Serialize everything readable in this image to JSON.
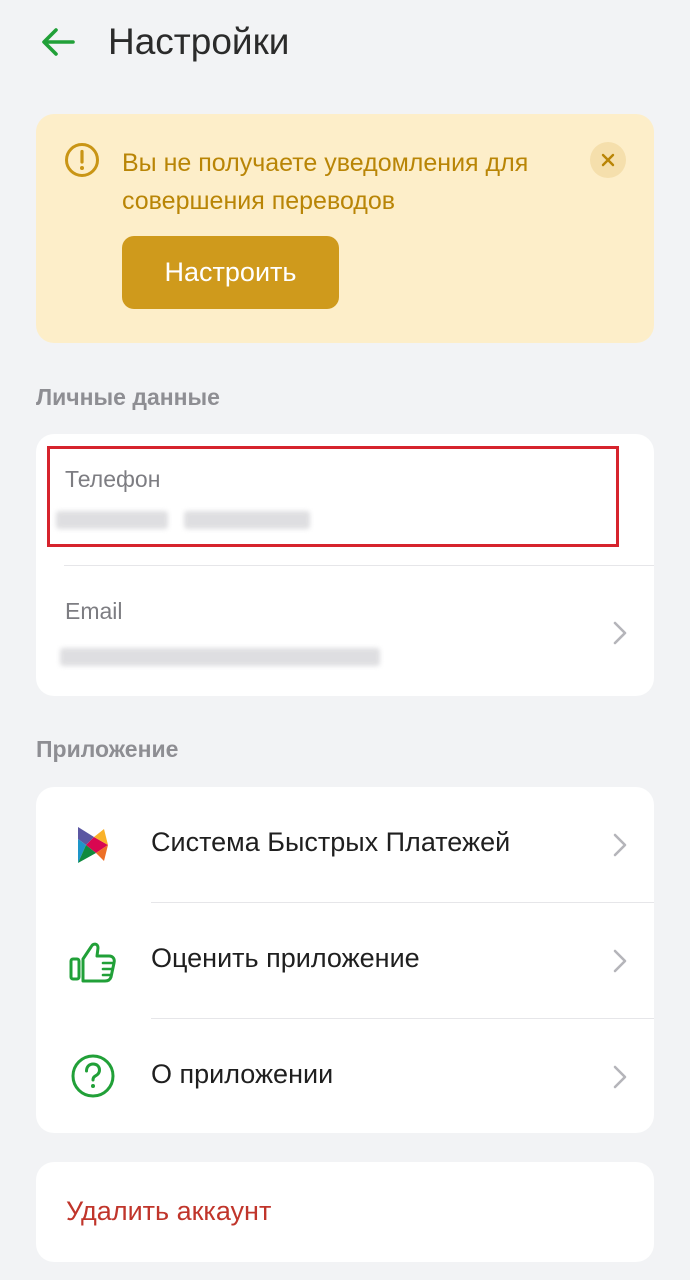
{
  "header": {
    "title": "Настройки",
    "back_icon": "arrow-left-icon"
  },
  "banner": {
    "text": "Вы не получаете уведомления для совершения переводов",
    "button_label": "Настроить",
    "warning_icon": "exclamation-circle-icon",
    "close_icon": "close-icon",
    "background": "#fdeec9",
    "accent": "#cf9a1c"
  },
  "personal": {
    "section_title": "Личные данные",
    "phone_label": "Телефон",
    "email_label": "Email"
  },
  "app": {
    "section_title": "Приложение",
    "items": [
      {
        "label": "Система Быстрых Платежей",
        "icon": "sbp-logo-icon"
      },
      {
        "label": "Оценить приложение",
        "icon": "thumbs-up-icon"
      },
      {
        "label": "О приложении",
        "icon": "question-circle-icon"
      }
    ]
  },
  "account": {
    "delete_label": "Удалить аккаунт",
    "delete_color": "#c0352b"
  },
  "colors": {
    "brand_green": "#21a038",
    "background": "#f2f3f5",
    "highlight": "#d6232d"
  }
}
